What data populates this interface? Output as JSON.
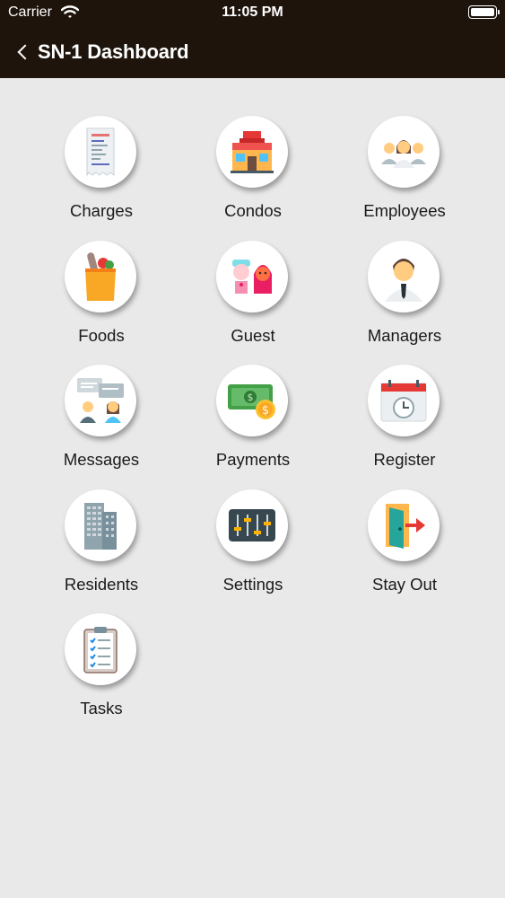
{
  "status_bar": {
    "carrier": "Carrier",
    "time": "11:05 PM"
  },
  "nav": {
    "title": "SN-1 Dashboard"
  },
  "tiles": [
    {
      "label": "Charges",
      "icon": "receipt-icon"
    },
    {
      "label": "Condos",
      "icon": "building-store-icon"
    },
    {
      "label": "Employees",
      "icon": "people-group-icon"
    },
    {
      "label": "Foods",
      "icon": "grocery-bag-icon"
    },
    {
      "label": "Guest",
      "icon": "guests-icon"
    },
    {
      "label": "Managers",
      "icon": "manager-icon"
    },
    {
      "label": "Messages",
      "icon": "chat-people-icon"
    },
    {
      "label": "Payments",
      "icon": "money-icon"
    },
    {
      "label": "Register",
      "icon": "calendar-clock-icon"
    },
    {
      "label": "Residents",
      "icon": "skyscraper-icon"
    },
    {
      "label": "Settings",
      "icon": "sliders-icon"
    },
    {
      "label": "Stay Out",
      "icon": "exit-door-icon"
    },
    {
      "label": "Tasks",
      "icon": "clipboard-checklist-icon"
    }
  ]
}
